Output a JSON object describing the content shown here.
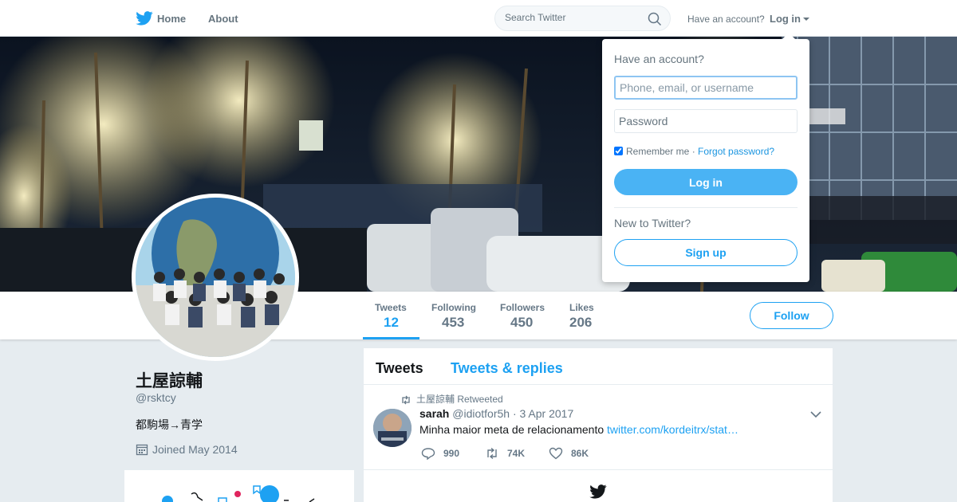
{
  "nav": {
    "home_label": "Home",
    "about_label": "About",
    "search_placeholder": "Search Twitter",
    "have_account": "Have an account?",
    "login_label": "Log in"
  },
  "profile": {
    "display_name": "土屋諒輔",
    "handle": "@rsktcy",
    "bio": "都駒場→青学",
    "joined": "Joined May 2014",
    "follow_label": "Follow",
    "stats": [
      {
        "label": "Tweets",
        "value": "12"
      },
      {
        "label": "Following",
        "value": "453"
      },
      {
        "label": "Followers",
        "value": "450"
      },
      {
        "label": "Likes",
        "value": "206"
      }
    ]
  },
  "timeline": {
    "tabs": [
      "Tweets",
      "Tweets & replies"
    ],
    "tweet": {
      "retweeted_by": "土屋諒輔 Retweeted",
      "author_name": "sarah",
      "author_handle": "@idiotfor5h",
      "date": "3 Apr 2017",
      "text": "Minha maior meta de relacionamento ",
      "link": "twitter.com/kordeitrx/stat…",
      "replies": "990",
      "retweets": "74K",
      "likes": "86K"
    }
  },
  "login_dropdown": {
    "title": "Have an account?",
    "username_placeholder": "Phone, email, or username",
    "password_placeholder": "Password",
    "remember_label": "Remember me",
    "separator": " · ",
    "forgot_label": "Forgot password?",
    "login_button": "Log in",
    "new_label": "New to Twitter?",
    "signup_button": "Sign up"
  },
  "colors": {
    "accent": "#1da1f2",
    "background": "#e6ecf0"
  }
}
